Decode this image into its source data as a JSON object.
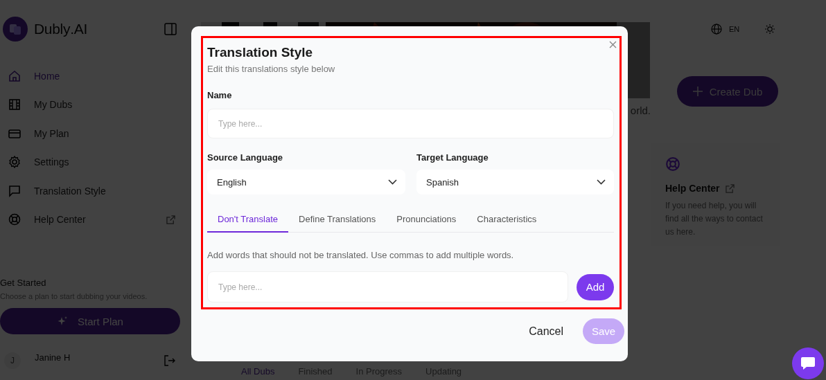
{
  "sidebar": {
    "brand": "**Dubly**.AI",
    "nav": [
      {
        "label": "Home",
        "selected": true,
        "external": false
      },
      {
        "label": "My Dubs",
        "selected": false,
        "external": false
      },
      {
        "label": "My Plan",
        "selected": false,
        "external": false
      },
      {
        "label": "Settings",
        "selected": false,
        "external": false
      },
      {
        "label": "Translation Style",
        "selected": false,
        "external": false
      },
      {
        "label": "Help Center",
        "selected": false,
        "external": true
      }
    ],
    "get_started": {
      "title": "Get Started",
      "text": "Choose a plan to start dubbing your videos.",
      "button": "Start Plan"
    },
    "user": {
      "initial": "J",
      "name": "Janine H"
    }
  },
  "header": {
    "language": "EN"
  },
  "main": {
    "intro_fragment": "orld.",
    "create_button": "Create Dub",
    "help_card": {
      "title": "Help Center",
      "text": "If you need help, you will find all the ways to contact us here."
    },
    "tabs": [
      {
        "label": "All Dubs",
        "selected": true
      },
      {
        "label": "Finished",
        "selected": false
      },
      {
        "label": "In Progress",
        "selected": false
      },
      {
        "label": "Updating",
        "selected": false
      }
    ]
  },
  "modal": {
    "title": "Translation Style",
    "subtitle": "Edit this translations style below",
    "name": {
      "label": "Name",
      "placeholder": "Type here..."
    },
    "source": {
      "label": "Source Language",
      "value": "English"
    },
    "target": {
      "label": "Target Language",
      "value": "Spanish"
    },
    "tabs": [
      {
        "label": "Don't Translate",
        "selected": true
      },
      {
        "label": "Define Translations",
        "selected": false
      },
      {
        "label": "Pronunciations",
        "selected": false
      },
      {
        "label": "Characteristics",
        "selected": false
      }
    ],
    "hint": "Add words that should not be translated. Use commas to add multiple words.",
    "words": {
      "placeholder": "Type here..."
    },
    "add_button": "Add",
    "cancel_button": "Cancel",
    "save_button": {
      "label": "Save",
      "disabled": true
    }
  }
}
